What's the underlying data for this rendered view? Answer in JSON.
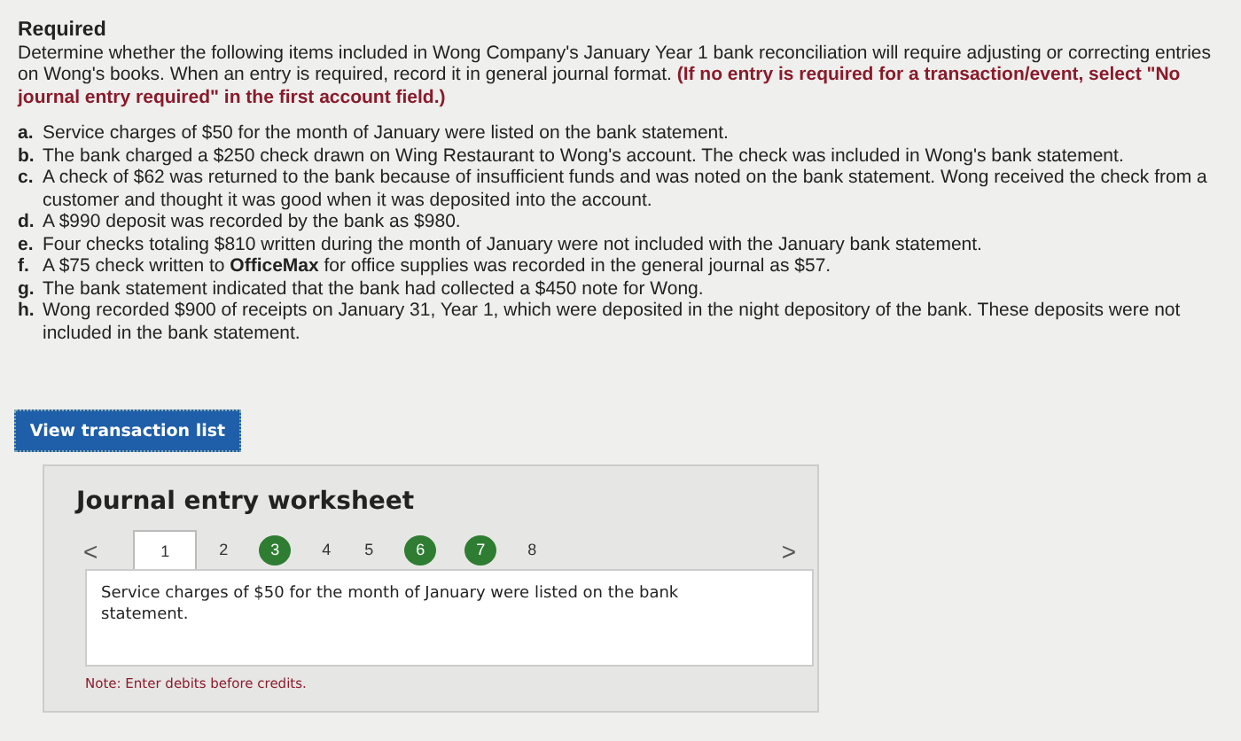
{
  "heading": "Required",
  "instructions": "Determine whether the following items included in Wong Company's January Year 1 bank reconciliation will require adjusting or correcting entries on Wong's books. When an entry is required, record it in general journal format. **(If no entry is required for a transaction/event, select \"No journal entry required\" in the first account field.)**",
  "items": [
    {
      "letter": "a.",
      "text": "Service charges of $50 for the month of January were listed on the bank statement."
    },
    {
      "letter": "b.",
      "text": "The bank charged a $250 check drawn on Wing Restaurant to Wong's account. The check was included in Wong's bank statement."
    },
    {
      "letter": "c.",
      "text": "A check of $62 was returned to the bank because of insufficient funds and was noted on the bank statement. Wong received the check from a customer and thought it was good when it was deposited into the account."
    },
    {
      "letter": "d.",
      "text": "A $990 deposit was recorded by the bank as $980."
    },
    {
      "letter": "e.",
      "text": "Four checks totaling $810 written during the month of January were not included with the January bank statement."
    },
    {
      "letter": "f.",
      "text": "A $75 check written to **OfficeMax** for office supplies was recorded in the general journal as $57."
    },
    {
      "letter": "g.",
      "text": "The bank statement indicated that the bank had collected a $450 note for Wong."
    },
    {
      "letter": "h.",
      "text": "Wong recorded $900 of receipts on January 31, Year 1, which were deposited in the night depository of the bank. These deposits were not included in the bank statement."
    }
  ],
  "view_button": "View transaction list",
  "worksheet": {
    "title": "Journal entry worksheet",
    "prev": "<",
    "next": ">",
    "tabs": [
      {
        "label": "1",
        "selected": true,
        "completed": false
      },
      {
        "label": "2",
        "selected": false,
        "completed": false
      },
      {
        "label": "3",
        "selected": false,
        "completed": true
      },
      {
        "label": "4",
        "selected": false,
        "completed": false
      },
      {
        "label": "5",
        "selected": false,
        "completed": false
      },
      {
        "label": "6",
        "selected": false,
        "completed": true
      },
      {
        "label": "7",
        "selected": false,
        "completed": true
      },
      {
        "label": "8",
        "selected": false,
        "completed": false
      }
    ],
    "description": "Service charges of $50 for the month of January were listed on the bank statement.",
    "note": "Note: Enter debits before credits."
  }
}
